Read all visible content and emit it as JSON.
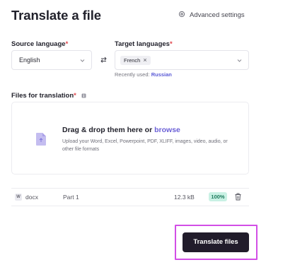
{
  "header": {
    "title": "Translate a file",
    "advanced_settings_label": "Advanced settings"
  },
  "source": {
    "label": "Source language",
    "required_mark": "*",
    "value": "English"
  },
  "target": {
    "label": "Target languages",
    "required_mark": "*",
    "chip_label": "French",
    "chip_remove": "×",
    "recently_used_prefix": "Recently used: ",
    "recently_used_value": "Russian"
  },
  "files": {
    "label": "Files for translation",
    "required_mark": "*",
    "dropzone_title": "Drag & drop them here or ",
    "dropzone_browse": "browse",
    "dropzone_subtitle": "Upload your Word, Excel, Powerpoint, PDF, XLIFF, images, video, audio, or other file formats"
  },
  "file_list": [
    {
      "type_badge": "W",
      "type": "docx",
      "name": "Part 1",
      "size": "12.3 kB",
      "progress": "100%"
    }
  ],
  "actions": {
    "translate_label": "Translate files"
  },
  "colors": {
    "accent": "#6a5fd6",
    "required": "#e0454b",
    "button": "#211c2b",
    "progress_badge_bg": "#c9f1e4",
    "progress_badge_text": "#1e7a5c",
    "highlight_outline": "#d24ee6"
  },
  "icons": {
    "advanced_settings": "gear-icon",
    "swap": "swap-arrows-icon",
    "select_chevron": "chevron-down-icon",
    "files_info": "info-icon",
    "upload_file": "file-icon",
    "delete": "trash-icon"
  }
}
